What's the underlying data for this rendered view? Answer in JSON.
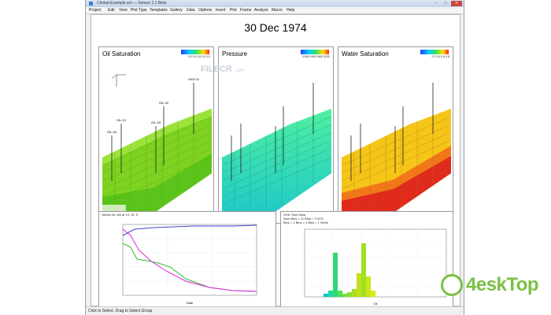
{
  "window": {
    "title": "Chekal-Example.ecl — Sensor 2.1 Beta"
  },
  "menu": [
    "Project",
    "Edit",
    "View",
    "Plot Type",
    "Templates",
    "Gallery",
    "Data",
    "Options",
    "Insert",
    "Plot",
    "Frame",
    "Analyze",
    "Macro",
    "Help"
  ],
  "main": {
    "title": "30 Dec 1974",
    "panels": [
      {
        "title": "Oil Saturation",
        "ticks": "0.2 0.4 0.6 0.8 1.0"
      },
      {
        "title": "Pressure",
        "ticks": "0    800    1600   2400   3200"
      },
      {
        "title": "Water Saturation",
        "ticks": "0.2 0.4 0.6 0.8"
      }
    ],
    "wells": [
      "GAS-01",
      "OIL-01",
      "OIL-02",
      "OIL-03",
      "OIL-04"
    ],
    "line_graph_title": "Values for cell at 13, 15, 5",
    "line_graph_xlabel": "Date",
    "histogram_lines": [
      "XOIL Sum Data",
      "Num Bins = 11 Bins = 71974",
      "Bins = 1 Bins = 1 Bins = 1 Grids"
    ],
    "histogram_xlabel": "Oil"
  },
  "status": "Click to Select, Drag to Select Group",
  "watermarks": {
    "filecr": "FILECR",
    "filecr_sub": ".com",
    "desktop": "4eskTop"
  },
  "colors": {
    "oil": "#7ed321",
    "pressure": "#3ddc97",
    "water": "#f5c518",
    "accent": "#e0e0e0"
  }
}
